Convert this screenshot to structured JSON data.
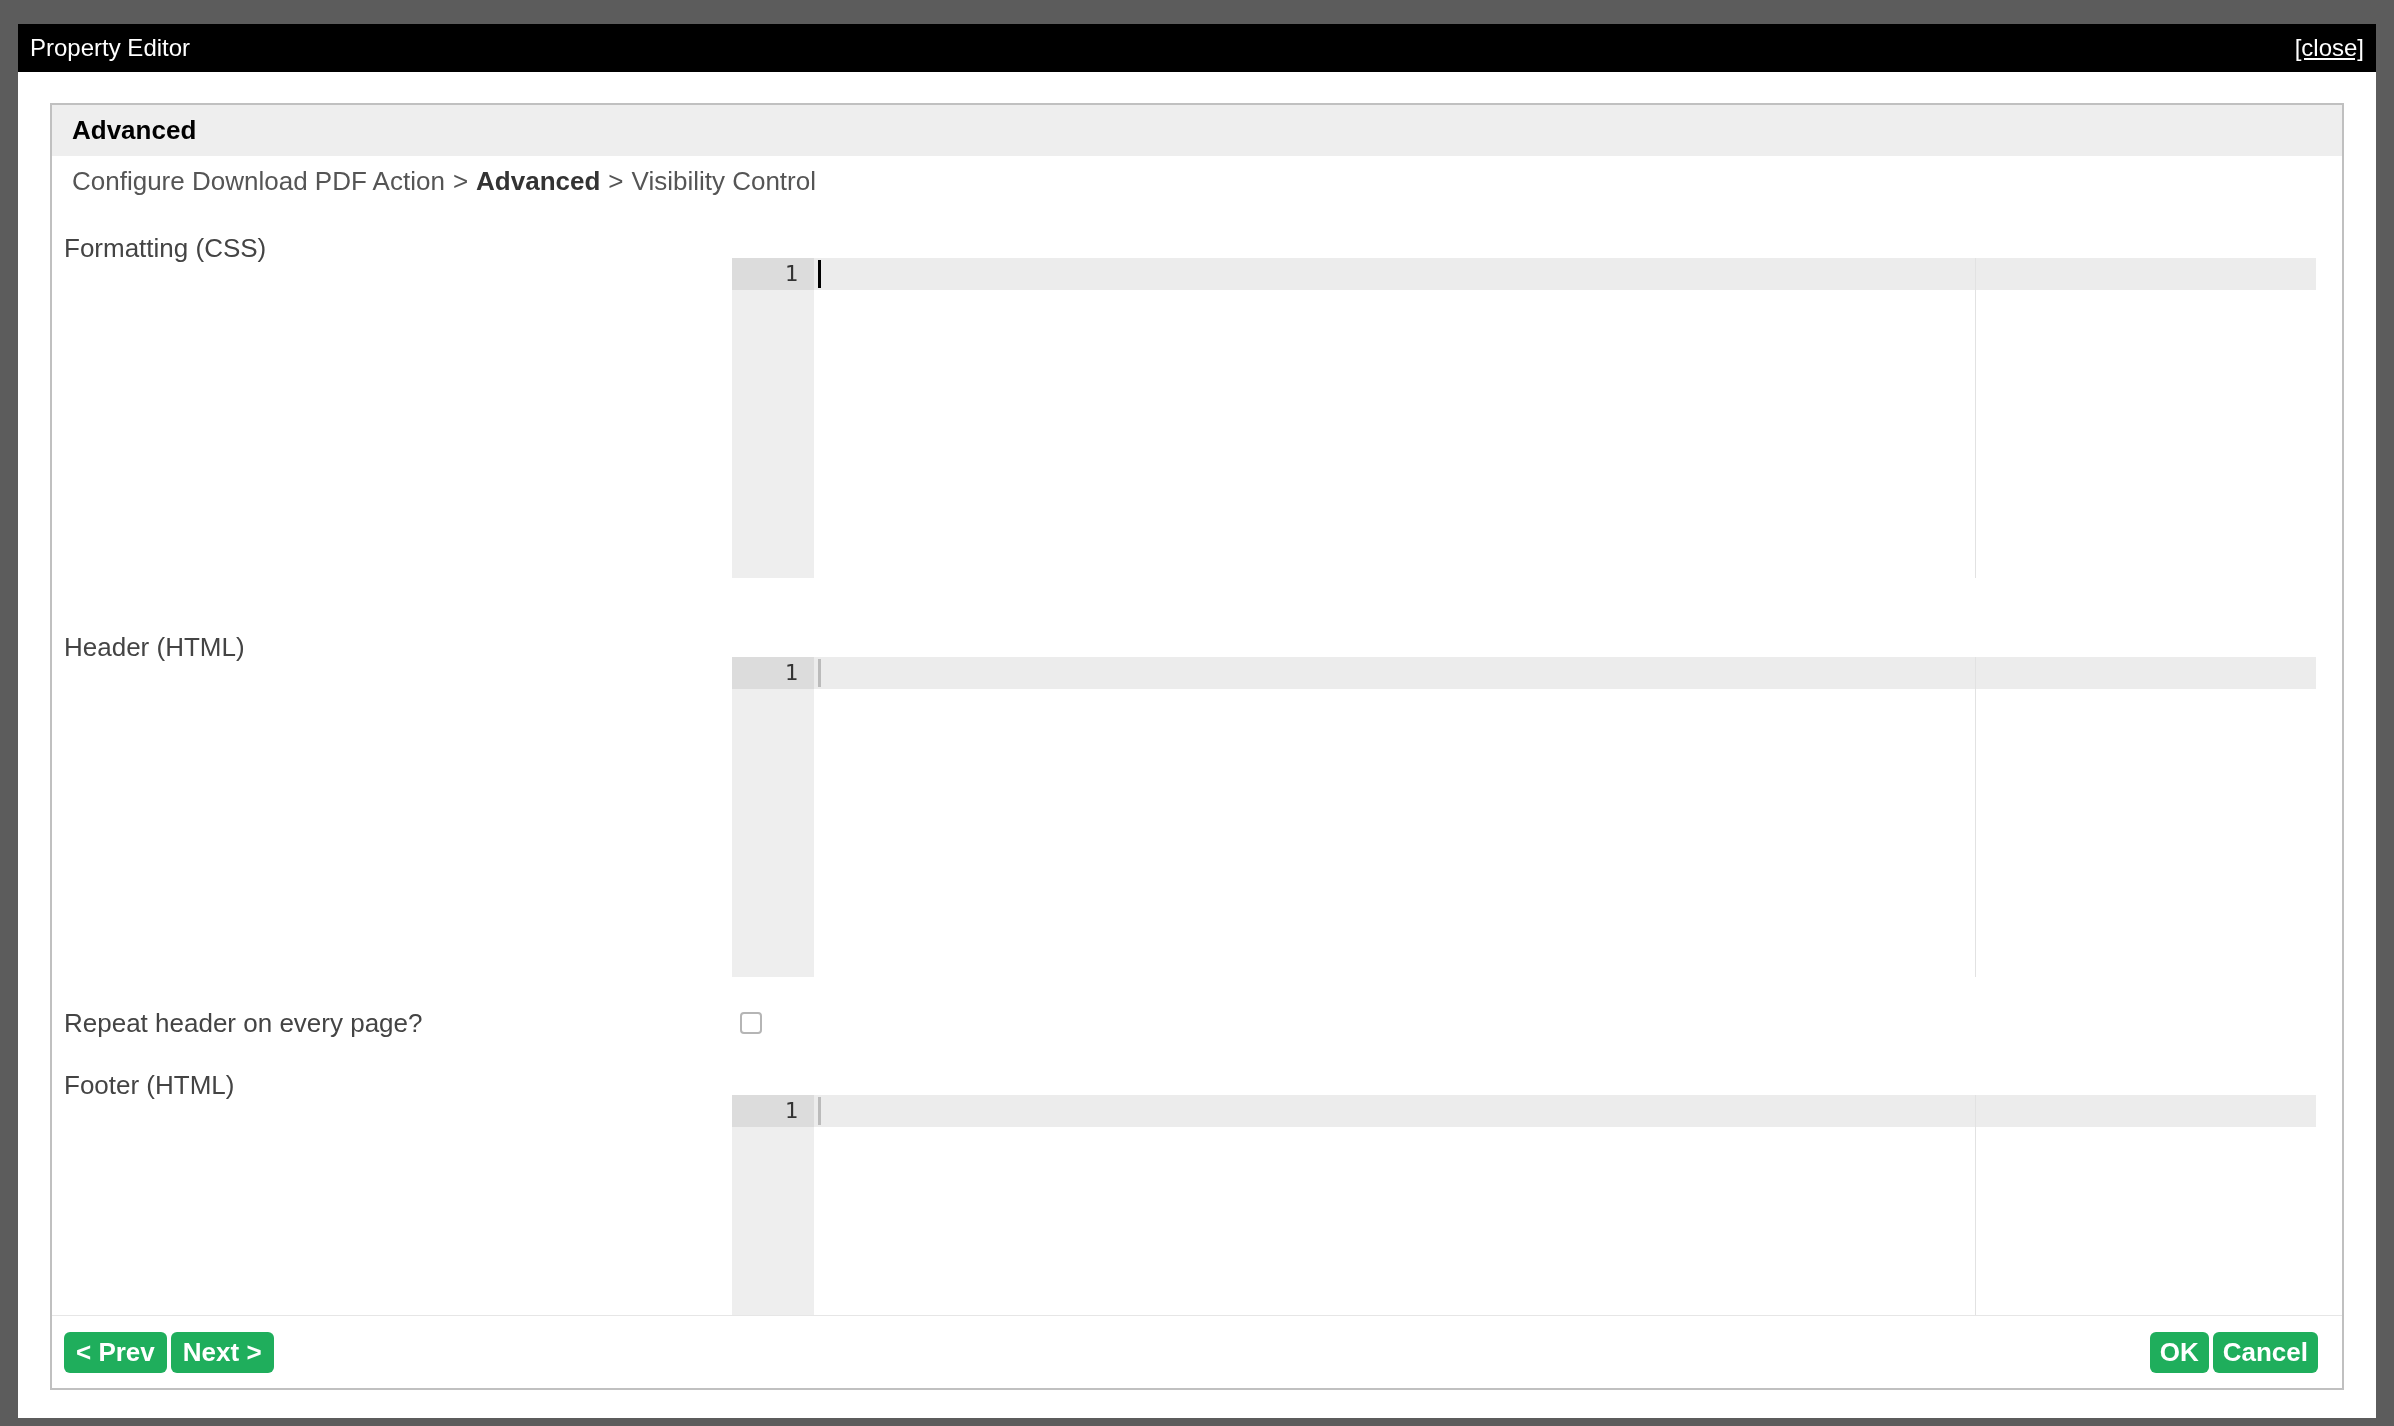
{
  "window": {
    "title": "Property Editor",
    "close": "[close]"
  },
  "panel": {
    "title": "Advanced"
  },
  "breadcrumb": [
    {
      "kind": "step",
      "label": "Configure Download PDF Action",
      "selected": false
    },
    {
      "kind": "separator",
      "label": ">"
    },
    {
      "kind": "step",
      "label": "Advanced",
      "selected": true
    },
    {
      "kind": "separator",
      "label": ">"
    },
    {
      "kind": "step",
      "label": "Visibility Control",
      "selected": false
    }
  ],
  "fields": [
    {
      "kind": "code",
      "label": "Formatting (CSS)",
      "line_number": "1",
      "focused": true
    },
    {
      "kind": "code",
      "label": "Header (HTML)",
      "line_number": "1",
      "focused": false
    },
    {
      "kind": "checkbox",
      "label": "Repeat header on every page?",
      "checked": false
    },
    {
      "kind": "code",
      "label": "Footer (HTML)",
      "line_number": "1",
      "focused": false
    }
  ],
  "nav_buttons": [
    "< Prev",
    "Next >"
  ],
  "action_buttons": [
    "OK",
    "Cancel"
  ]
}
